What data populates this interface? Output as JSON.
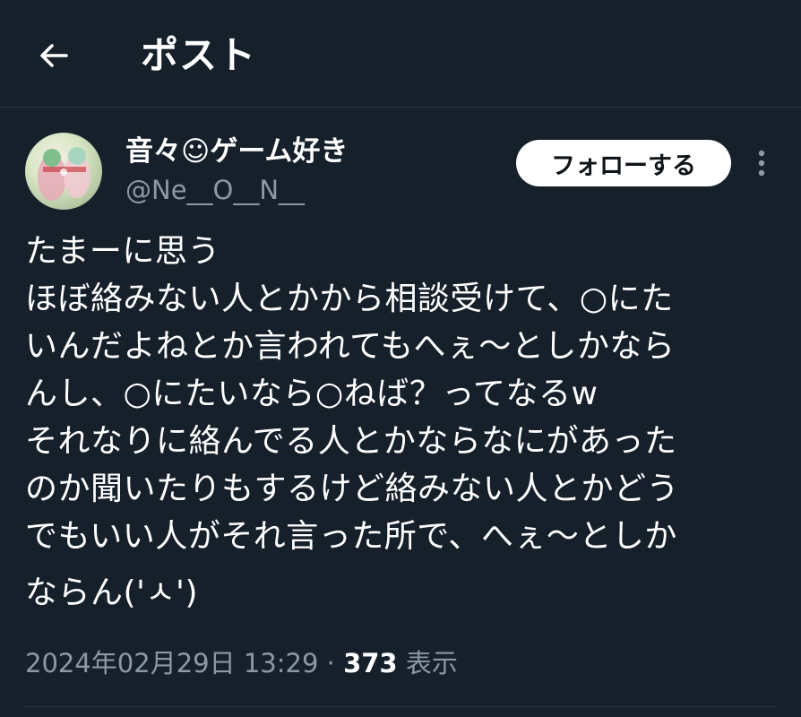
{
  "header": {
    "title": "ポスト",
    "back_icon": "arrow-left-icon"
  },
  "author": {
    "display_name": "音々☺ゲーム好き",
    "handle": "@Ne__O__N__",
    "follow_label": "フォローする",
    "more_icon": "vertical-dots-icon"
  },
  "tweet": {
    "lines": [
      "たまーに思う",
      "ほぼ絡みない人とかから相談受けて、○にた",
      "いんだよねとか言われてもへぇ～としかなら",
      "んし、○にたいなら○ねば？ってなるw",
      "それなりに絡んでる人とかならなにがあった",
      "のか聞いたりもするけど絡みない人とかどう",
      "でもいい人がそれ言った所で、へぇ～としか",
      "ならん('ㅅ')"
    ]
  },
  "meta": {
    "timestamp": "2024年02月29日 13:29",
    "separator": "·",
    "views_count": "373",
    "views_label": "表示"
  },
  "colors": {
    "background": "#15202b",
    "text": "#ffffff",
    "muted": "#8b98a5",
    "divider": "#2b3640",
    "button_bg": "#ffffff",
    "button_text": "#0f1419"
  }
}
